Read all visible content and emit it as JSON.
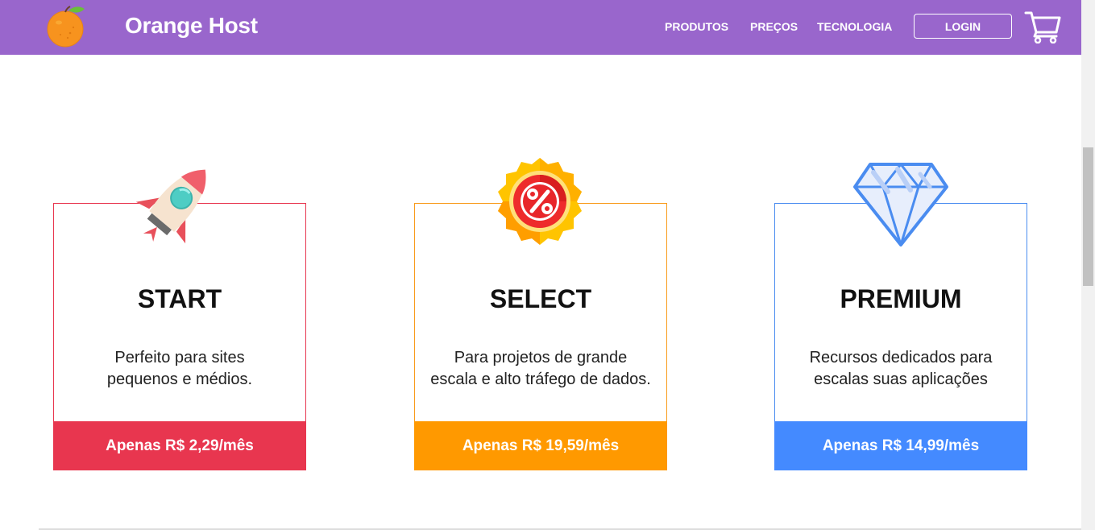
{
  "header": {
    "brand": "Orange Host",
    "nav": [
      "PRODUTOS",
      "PREÇOS",
      "TECNOLOGIA"
    ],
    "login_label": "LOGIN",
    "logo_icon": "orange-icon",
    "cart_icon": "shopping-cart-icon",
    "background_color": "#9966cc"
  },
  "plans": [
    {
      "icon": "rocket-icon",
      "title": "START",
      "description_line1": "Perfeito para sites",
      "description_line2": "pequenos e médios.",
      "price": "Apenas R$ 2,29/mês",
      "color": "#e8364f"
    },
    {
      "icon": "percent-badge-icon",
      "title": "SELECT",
      "description_line1": "Para projetos de grande",
      "description_line2": "escala e alto tráfego de dados.",
      "price": "Apenas R$ 19,59/mês",
      "color": "#ff9900"
    },
    {
      "icon": "diamond-icon",
      "title": "PREMIUM",
      "description_line1": "Recursos dedicados para",
      "description_line2": "escalas suas aplicações",
      "price": "Apenas R$ 14,99/mês",
      "color": "#448aff"
    }
  ]
}
